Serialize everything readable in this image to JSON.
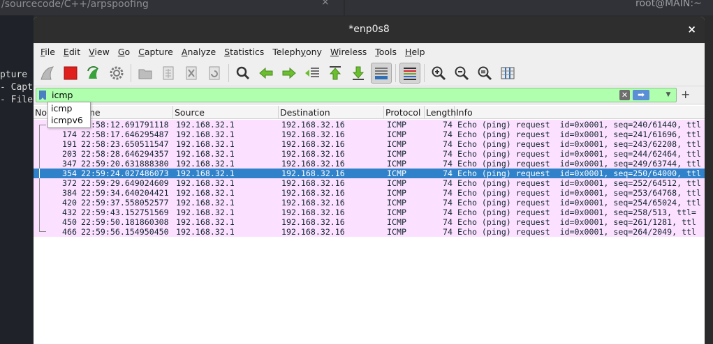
{
  "background": {
    "left_title": "/sourcecode/C++/arpspoofing",
    "left_close": "×",
    "right_title": "root@MAIN:~",
    "terminal_lines": [
      "pture",
      "- Capt",
      "- File"
    ]
  },
  "window": {
    "title": "*enp0s8",
    "close": "×"
  },
  "menu": [
    {
      "label": "File",
      "u": "F",
      "rest": "ile"
    },
    {
      "label": "Edit",
      "u": "E",
      "rest": "dit"
    },
    {
      "label": "View",
      "u": "V",
      "rest": "iew"
    },
    {
      "label": "Go",
      "u": "G",
      "rest": "o"
    },
    {
      "label": "Capture",
      "u": "C",
      "rest": "apture"
    },
    {
      "label": "Analyze",
      "u": "A",
      "rest": "nalyze"
    },
    {
      "label": "Statistics",
      "u": "S",
      "rest": "tatistics"
    },
    {
      "label": "Telephony",
      "u": "y",
      "pre": "Teleph",
      "rest2": "ony"
    },
    {
      "label": "Wireless",
      "u": "W",
      "rest": "ireless"
    },
    {
      "label": "Tools",
      "u": "T",
      "rest": "ools"
    },
    {
      "label": "Help",
      "u": "H",
      "rest": "elp"
    }
  ],
  "filter": {
    "value": "icmp",
    "suggestions": [
      "icmp",
      "icmpv6"
    ]
  },
  "columns": [
    "No.",
    "Time",
    "Source",
    "Destination",
    "Protocol",
    "Length",
    "Info"
  ],
  "packets": [
    {
      "no": "",
      "time": "22:58:12.691791118",
      "src": "192.168.32.1",
      "dst": "192.168.32.16",
      "proto": "ICMP",
      "len": "74",
      "info": "Echo (ping) request  id=0x0001, seq=240/61440, ttl",
      "sel": false
    },
    {
      "no": "174",
      "time": "22:58:17.646295487",
      "src": "192.168.32.1",
      "dst": "192.168.32.16",
      "proto": "ICMP",
      "len": "74",
      "info": "Echo (ping) request  id=0x0001, seq=241/61696, ttl",
      "sel": false
    },
    {
      "no": "191",
      "time": "22:58:23.650511547",
      "src": "192.168.32.1",
      "dst": "192.168.32.16",
      "proto": "ICMP",
      "len": "74",
      "info": "Echo (ping) request  id=0x0001, seq=243/62208, ttl",
      "sel": false
    },
    {
      "no": "203",
      "time": "22:58:28.646294357",
      "src": "192.168.32.1",
      "dst": "192.168.32.16",
      "proto": "ICMP",
      "len": "74",
      "info": "Echo (ping) request  id=0x0001, seq=244/62464, ttl",
      "sel": false
    },
    {
      "no": "347",
      "time": "22:59:20.631888380",
      "src": "192.168.32.1",
      "dst": "192.168.32.16",
      "proto": "ICMP",
      "len": "74",
      "info": "Echo (ping) request  id=0x0001, seq=249/63744, ttl",
      "sel": false
    },
    {
      "no": "354",
      "time": "22:59:24.027486073",
      "src": "192.168.32.1",
      "dst": "192.168.32.16",
      "proto": "ICMP",
      "len": "74",
      "info": "Echo (ping) request  id=0x0001, seq=250/64000, ttl",
      "sel": true
    },
    {
      "no": "372",
      "time": "22:59:29.649024609",
      "src": "192.168.32.1",
      "dst": "192.168.32.16",
      "proto": "ICMP",
      "len": "74",
      "info": "Echo (ping) request  id=0x0001, seq=252/64512, ttl",
      "sel": false
    },
    {
      "no": "384",
      "time": "22:59:34.640204421",
      "src": "192.168.32.1",
      "dst": "192.168.32.16",
      "proto": "ICMP",
      "len": "74",
      "info": "Echo (ping) request  id=0x0001, seq=253/64768, ttl",
      "sel": false
    },
    {
      "no": "420",
      "time": "22:59:37.558052577",
      "src": "192.168.32.1",
      "dst": "192.168.32.16",
      "proto": "ICMP",
      "len": "74",
      "info": "Echo (ping) request  id=0x0001, seq=254/65024, ttl",
      "sel": false
    },
    {
      "no": "432",
      "time": "22:59:43.152751569",
      "src": "192.168.32.1",
      "dst": "192.168.32.16",
      "proto": "ICMP",
      "len": "74",
      "info": "Echo (ping) request  id=0x0001, seq=258/513, ttl=",
      "sel": false
    },
    {
      "no": "450",
      "time": "22:59:50.181860308",
      "src": "192.168.32.1",
      "dst": "192.168.32.16",
      "proto": "ICMP",
      "len": "74",
      "info": "Echo (ping) request  id=0x0001, seq=261/1281, ttl",
      "sel": false
    },
    {
      "no": "466",
      "time": "22:59:56.154950450",
      "src": "192.168.32.1",
      "dst": "192.168.32.16",
      "proto": "ICMP",
      "len": "74",
      "info": "Echo (ping) request  id=0x0001, seq=264/2049, ttl",
      "sel": false
    }
  ],
  "colors": {
    "filter_valid": "#afffaf",
    "icmp_row": "#fce0ff",
    "selected_row": "#2f82c9",
    "stop_button": "#e0201c",
    "shark_fin": "#3a8ad6"
  }
}
